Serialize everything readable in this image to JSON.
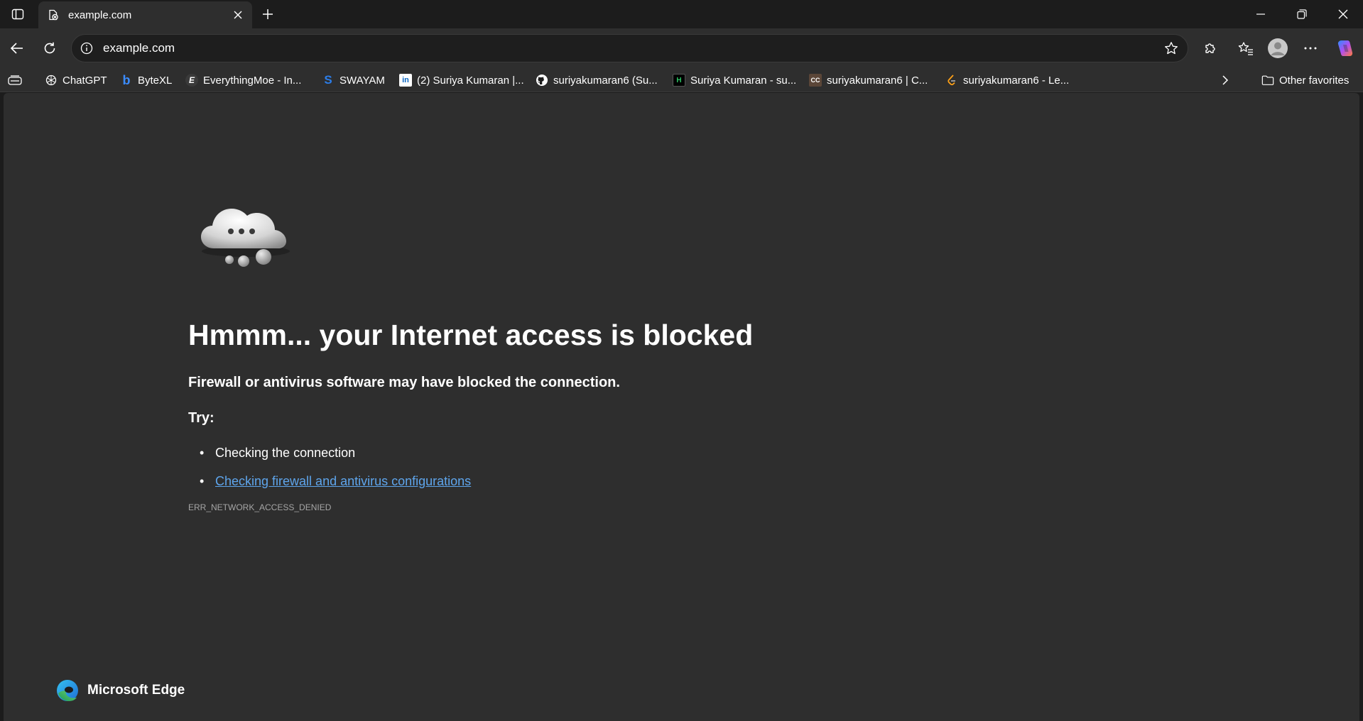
{
  "tab": {
    "title": "example.com",
    "favicon": "blocked-page-icon"
  },
  "address": {
    "url": "example.com"
  },
  "favorites": [
    {
      "label": "ChatGPT",
      "icon": "chatgpt-icon"
    },
    {
      "label": "ByteXL",
      "icon": "bytexl-icon"
    },
    {
      "label": "EverythingMoe - In...",
      "icon": "everythingmoe-icon"
    },
    {
      "label": "SWAYAM",
      "icon": "swayam-icon"
    },
    {
      "label": "(2) Suriya Kumaran |...",
      "icon": "linkedin-icon"
    },
    {
      "label": "suriyakumaran6 (Su...",
      "icon": "github-icon"
    },
    {
      "label": "Suriya Kumaran - su...",
      "icon": "hackerrank-icon"
    },
    {
      "label": "suriyakumaran6 | C...",
      "icon": "codechef-icon"
    },
    {
      "label": "suriyakumaran6 - Le...",
      "icon": "leetcode-icon"
    }
  ],
  "other_favorites": "Other favorites",
  "error": {
    "headline": "Hmmm... your Internet access is blocked",
    "subline": "Firewall or antivirus software may have blocked the connection.",
    "try_label": "Try:",
    "suggestions": [
      "Checking the connection",
      "Checking firewall and antivirus configurations"
    ],
    "code": "ERR_NETWORK_ACCESS_DENIED"
  },
  "brand": {
    "name": "Microsoft Edge"
  },
  "colors": {
    "accent_link": "#5ea5ec",
    "page_bg": "#2e2e2e",
    "chrome_bg": "#1c1c1c"
  }
}
